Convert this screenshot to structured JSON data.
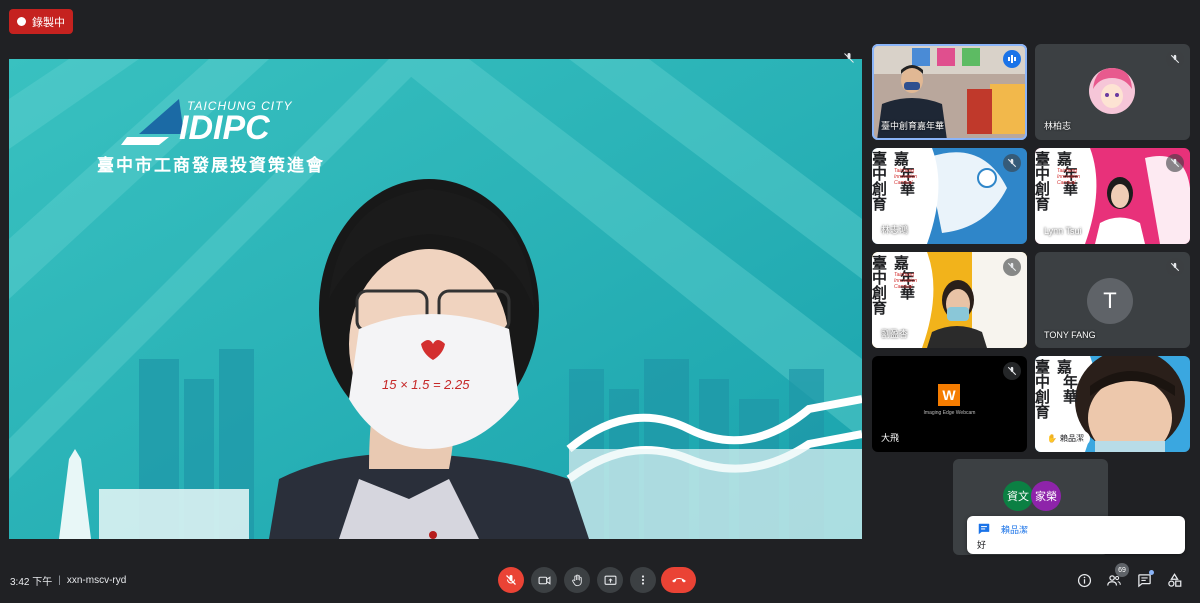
{
  "recording": {
    "label": "錄製中"
  },
  "main_speaker": {
    "name": "",
    "backdrop": {
      "logo_city": "TAICHUNG CITY",
      "logo_text": "IDIPC",
      "org_name": "臺中市工商發展投資策進會"
    },
    "mask_text": "15 × 1.5 = 2.25"
  },
  "tiles": [
    {
      "name": "臺中創育嘉年華"
    },
    {
      "name": "林柏志"
    },
    {
      "name": "林志鴻"
    },
    {
      "name": "Lynn Tsui"
    },
    {
      "name": "劉盈杏"
    },
    {
      "name": "TONY FANG",
      "initial": "T"
    },
    {
      "name": "大飛",
      "webcam_label": "Imaging Edge Webcam"
    },
    {
      "name": "賴品潔"
    }
  ],
  "carnival": {
    "chars_left": [
      "臺",
      "中",
      "創",
      "育"
    ],
    "chars_right": [
      "嘉",
      "年",
      "華"
    ],
    "en": "Taichung Innovation Carnival"
  },
  "presence": {
    "chips": [
      {
        "text": "資文",
        "color": "#0b8043"
      },
      {
        "text": "家榮",
        "color": "#8e24aa"
      }
    ]
  },
  "chat_toast": {
    "sender": "賴品潔",
    "message": "好"
  },
  "bottom_bar": {
    "time": "3:42 下午",
    "separator": "|",
    "meeting_code": "xxn-mscv-ryd",
    "participants_count": "69"
  },
  "colors": {
    "end_call": "#ea4335",
    "recording": "#c5221f",
    "active_outline": "#8ab4f8"
  }
}
